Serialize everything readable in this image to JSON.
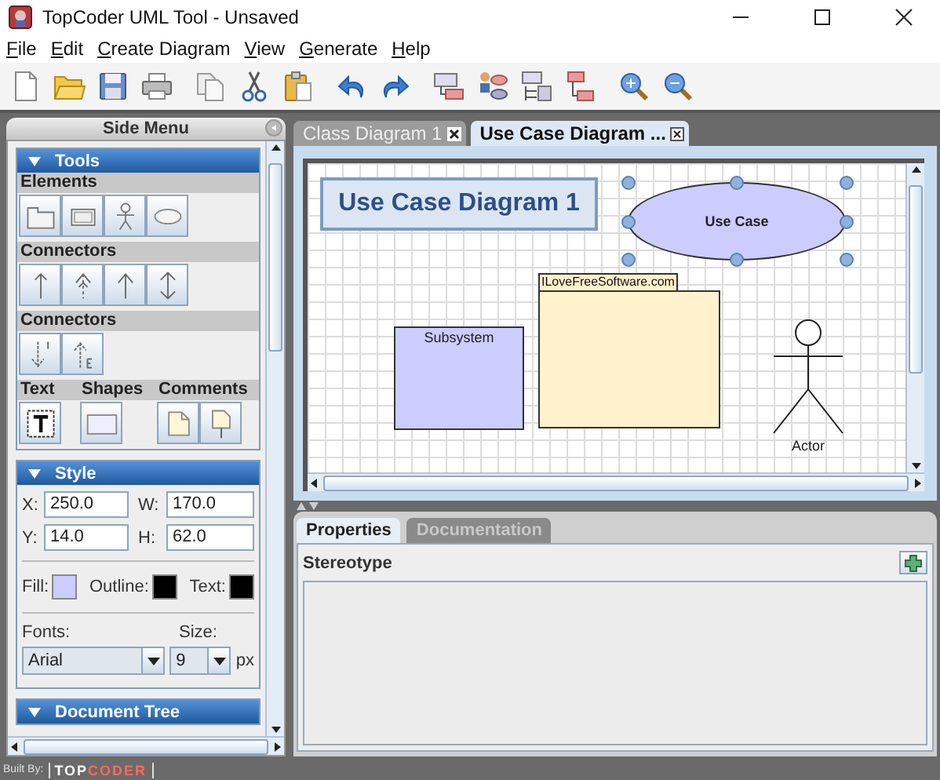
{
  "window": {
    "title": "TopCoder UML Tool - Unsaved"
  },
  "menu": [
    {
      "label": "File"
    },
    {
      "label": "Edit"
    },
    {
      "label": "Create Diagram"
    },
    {
      "label": "View"
    },
    {
      "label": "Generate"
    },
    {
      "label": "Help"
    }
  ],
  "side_menu": {
    "title": "Side Menu",
    "sections": [
      {
        "kind": "tools",
        "title": "Tools",
        "groups": [
          {
            "label": "Elements"
          },
          {
            "label": "Connectors"
          },
          {
            "label": "Connectors"
          }
        ],
        "bottom_groups": [
          {
            "label": "Text"
          },
          {
            "label": "Shapes"
          },
          {
            "label": "Comments"
          }
        ]
      },
      {
        "kind": "style",
        "title": "Style",
        "fields": [
          {
            "label": "X:",
            "value": "250.0"
          },
          {
            "label": "W:",
            "value": "170.0"
          },
          {
            "label": "Y:",
            "value": "14.0"
          },
          {
            "label": "H:",
            "value": "62.0"
          }
        ],
        "swatches": [
          {
            "label": "Fill:",
            "color": "#ccccff"
          },
          {
            "label": "Outline:",
            "color": "#000000"
          },
          {
            "label": "Text:",
            "color": "#000000"
          }
        ],
        "font_label": "Fonts:",
        "font": "Arial",
        "size_label": "Size:",
        "size": "9",
        "unit": "px"
      },
      {
        "kind": "tree",
        "title": "Document Tree"
      }
    ]
  },
  "tabs": [
    {
      "label": "Class Diagram 1",
      "selected": false
    },
    {
      "label": "Use Case Diagram ...",
      "selected": true
    }
  ],
  "diagram": {
    "title": "Use Case Diagram 1",
    "elements": [
      {
        "kind": "use_case",
        "label": "Use Case",
        "selected": true
      },
      {
        "kind": "package",
        "label": "ILoveFreeSoftware.com",
        "selected": false
      },
      {
        "kind": "subsystem",
        "label": "Subsystem",
        "selected": false
      },
      {
        "kind": "actor",
        "label": "Actor",
        "selected": false
      }
    ]
  },
  "properties": {
    "tabs": [
      {
        "label": "Properties",
        "selected": true
      },
      {
        "label": "Documentation",
        "selected": false
      }
    ],
    "label": "Stereotype"
  },
  "footer": {
    "label": "Built By:",
    "logo_start": "TOP",
    "logo_end": "CODER"
  }
}
